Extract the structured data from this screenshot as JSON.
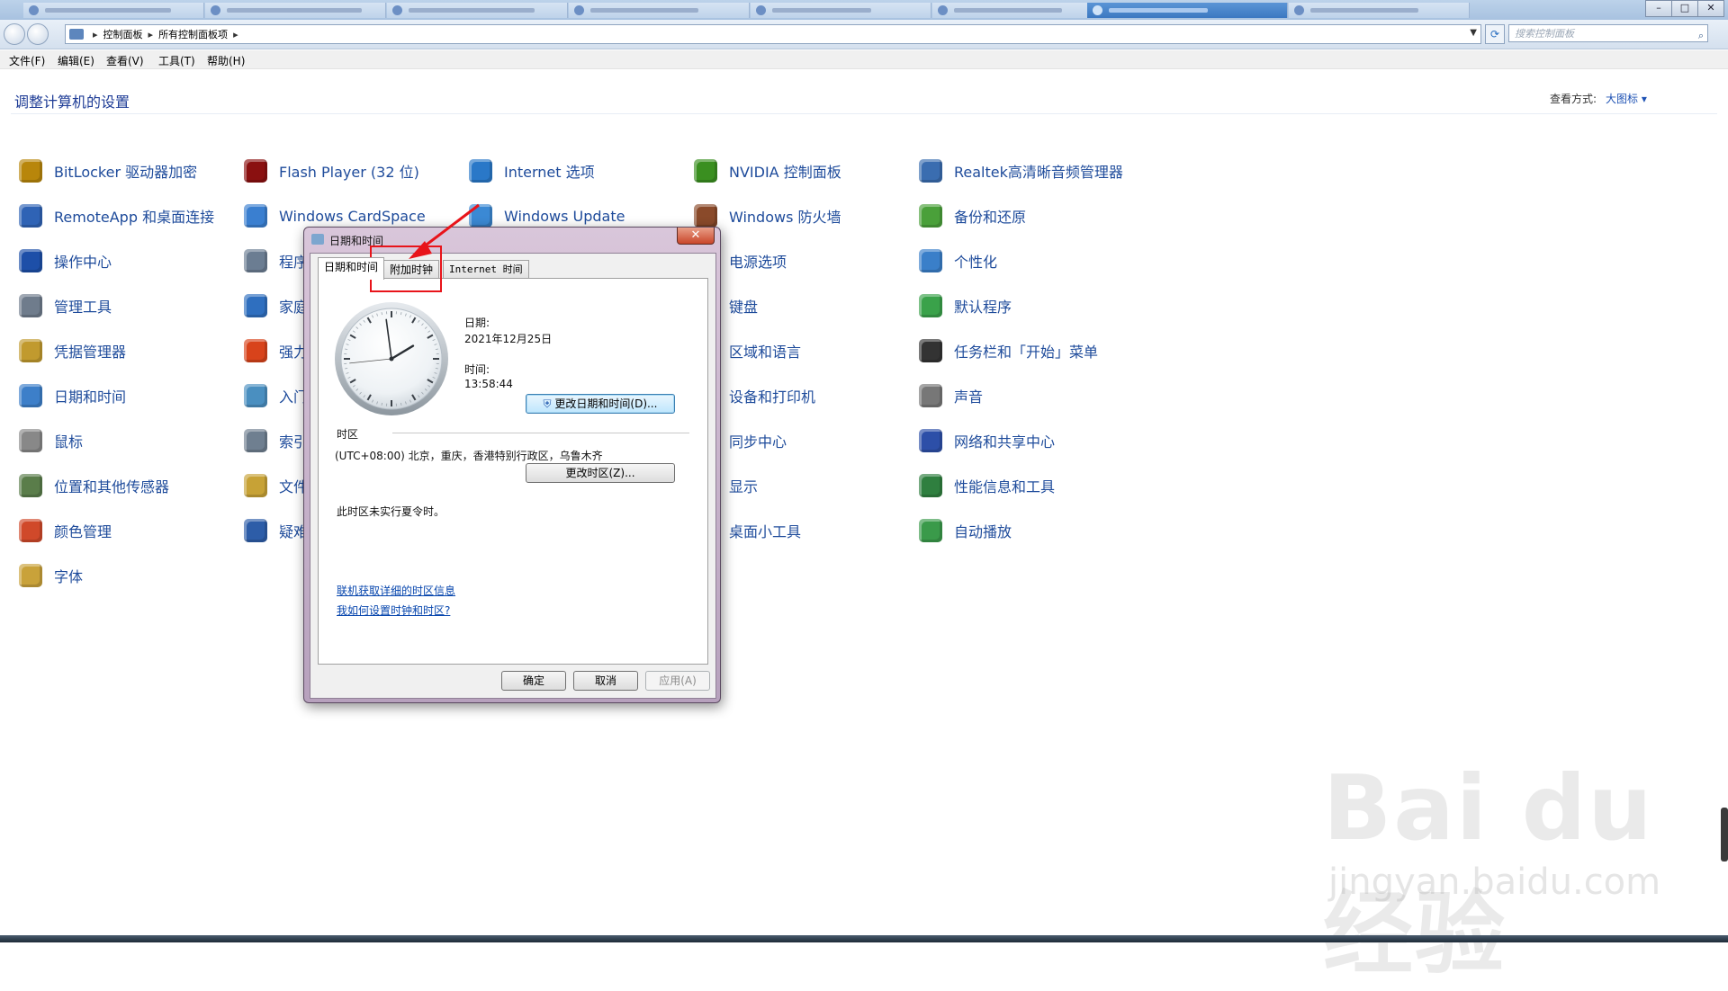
{
  "window": {
    "minimize": "–",
    "maximize": "□",
    "close": "✕"
  },
  "address_bar": {
    "crumbs": [
      "控制面板",
      "所有控制面板项"
    ],
    "search_placeholder": "搜索控制面板"
  },
  "menu": [
    "文件(F)",
    "编辑(E)",
    "查看(V)",
    "工具(T)",
    "帮助(H)"
  ],
  "page": {
    "heading": "调整计算机的设置",
    "view_by_label": "查看方式:",
    "view_by_value": "大图标 ▾"
  },
  "items": {
    "col1": [
      "BitLocker 驱动器加密",
      "RemoteApp 和桌面连接",
      "操作中心",
      "管理工具",
      "凭据管理器",
      "日期和时间",
      "鼠标",
      "位置和其他传感器",
      "颜色管理",
      "字体"
    ],
    "col2": [
      "Flash Player (32 位)",
      "Windows CardSpace",
      "程序",
      "家庭",
      "强力",
      "入门",
      "索引",
      "文件",
      "疑难"
    ],
    "col3": [
      "Internet 选项",
      "Windows Update"
    ],
    "col4": [
      "NVIDIA 控制面板",
      "Windows 防火墙",
      "电源选项",
      "键盘",
      "区域和语言",
      "设备和打印机",
      "同步中心",
      "显示",
      "桌面小工具"
    ],
    "col5": [
      "Realtek高清晰音频管理器",
      "备份和还原",
      "个性化",
      "默认程序",
      "任务栏和「开始」菜单",
      "声音",
      "网络和共享中心",
      "性能信息和工具",
      "自动播放"
    ]
  },
  "icons": {
    "col1": [
      "bitlocker-icon",
      "remoteapp-icon",
      "action-center-flag-icon",
      "admin-tools-icon",
      "credential-vault-icon",
      "calendar-clock-icon",
      "mouse-icon",
      "location-sensor-icon",
      "color-management-icon",
      "fonts-folder-icon"
    ],
    "col2": [
      "flash-player-icon",
      "cardspace-icon",
      "programs-icon",
      "homegroup-icon",
      "four-color-icon",
      "getting-started-icon",
      "indexing-icon",
      "folder-options-icon",
      "troubleshoot-icon"
    ],
    "col3": [
      "internet-options-icon",
      "windows-update-icon"
    ],
    "col4": [
      "nvidia-icon",
      "firewall-icon",
      "power-options-icon",
      "keyboard-icon",
      "region-language-icon",
      "devices-printers-icon",
      "sync-center-icon",
      "display-icon",
      "gadgets-icon"
    ],
    "col5": [
      "realtek-audio-icon",
      "backup-restore-icon",
      "personalization-icon",
      "default-programs-icon",
      "taskbar-start-icon",
      "sound-icon",
      "network-sharing-icon",
      "performance-icon",
      "autoplay-icon"
    ]
  },
  "dialog": {
    "title": "日期和时间",
    "close": "✕",
    "tabs": [
      "日期和时间",
      "附加时钟",
      "Internet 时间"
    ],
    "date_label": "日期:",
    "date_value": "2021年12月25日",
    "time_label": "时间:",
    "time_value": "13:58:44",
    "change_datetime_button": "更改日期和时间(D)...",
    "timezone_heading": "时区",
    "timezone_value": "(UTC+08:00) 北京，重庆，香港特别行政区，乌鲁木齐",
    "change_timezone_button": "更改时区(Z)...",
    "dst_note": "此时区未实行夏令时。",
    "link_online_info": "联机获取详细的时区信息",
    "link_how_to": "我如何设置时钟和时区?",
    "ok": "确定",
    "cancel": "取消",
    "apply": "应用(A)"
  },
  "clock": {
    "hours": 13,
    "minutes": 58,
    "seconds": 44
  },
  "watermark": {
    "brand": "Bai du 经验",
    "url": "jingyan.baidu.com"
  },
  "colors": {
    "link_blue": "#1e4b9b",
    "heading_blue": "#1e3c96",
    "highlight_red": "#e8141a"
  }
}
